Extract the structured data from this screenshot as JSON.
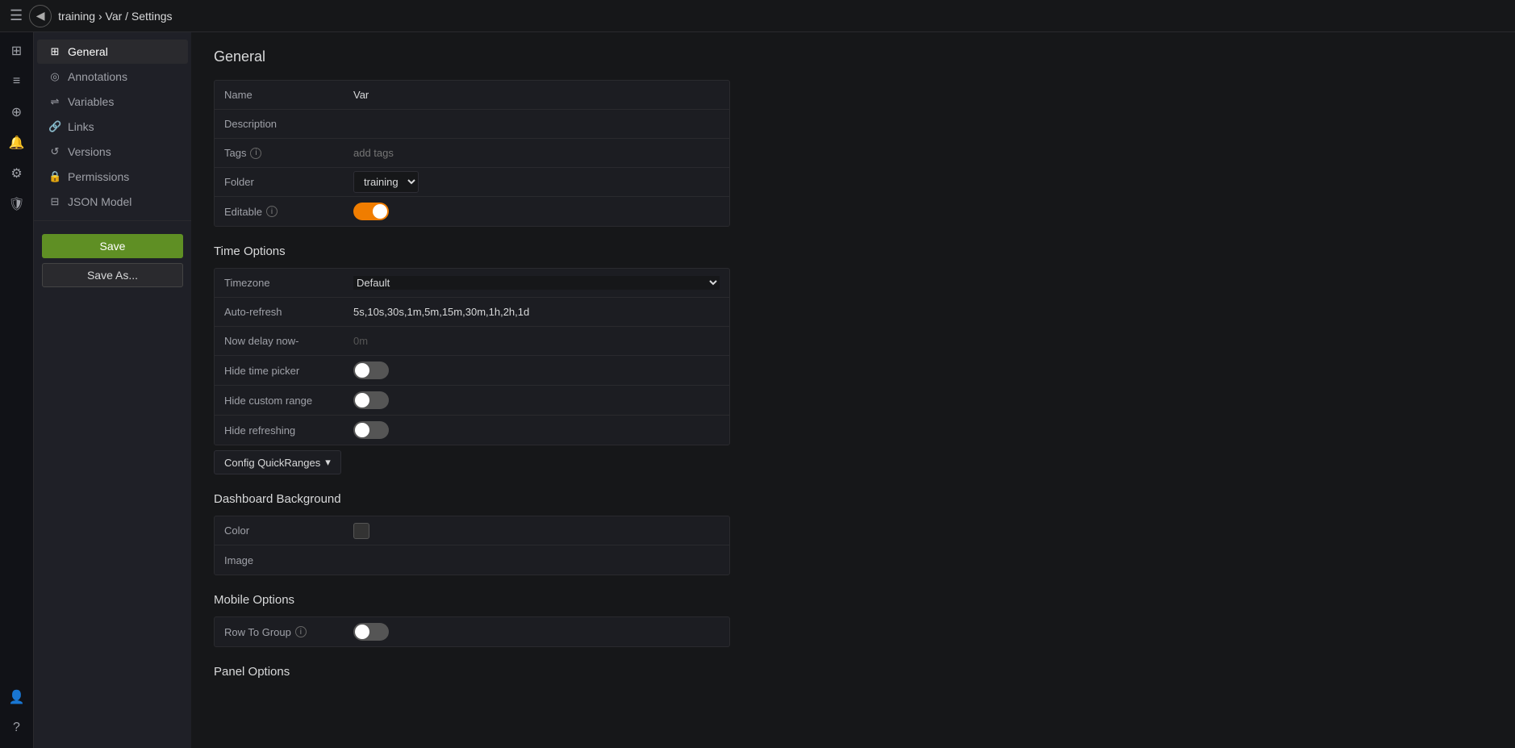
{
  "topbar": {
    "menu_label": "☰",
    "back_label": "◀",
    "breadcrumb_prefix": "training",
    "breadcrumb_separator": " › ",
    "breadcrumb_current": "Var / Settings"
  },
  "sidebar": {
    "items": [
      {
        "id": "general",
        "label": "General",
        "icon": "⊞",
        "active": true
      },
      {
        "id": "annotations",
        "label": "Annotations",
        "icon": "◎"
      },
      {
        "id": "variables",
        "label": "Variables",
        "icon": "⇌"
      },
      {
        "id": "links",
        "label": "Links",
        "icon": "🔗"
      },
      {
        "id": "versions",
        "label": "Versions",
        "icon": "↺"
      },
      {
        "id": "permissions",
        "label": "Permissions",
        "icon": "🔒"
      },
      {
        "id": "json-model",
        "label": "JSON Model",
        "icon": "⊟"
      }
    ],
    "save_label": "Save",
    "save_as_label": "Save As..."
  },
  "iconbar": {
    "icons": [
      {
        "id": "hamburger",
        "symbol": "☰"
      },
      {
        "id": "apps",
        "symbol": "⊞"
      },
      {
        "id": "list",
        "symbol": "☰"
      },
      {
        "id": "globe",
        "symbol": "⊕"
      },
      {
        "id": "bell",
        "symbol": "🔔"
      },
      {
        "id": "gear",
        "symbol": "⚙"
      },
      {
        "id": "shield",
        "symbol": "🛡"
      },
      {
        "id": "user-bottom",
        "symbol": "👤"
      },
      {
        "id": "help",
        "symbol": "?"
      }
    ]
  },
  "general": {
    "section_title": "General",
    "fields": {
      "name_label": "Name",
      "name_value": "Var",
      "description_label": "Description",
      "description_value": "",
      "tags_label": "Tags",
      "tags_placeholder": "add tags",
      "folder_label": "Folder",
      "folder_value": "training",
      "editable_label": "Editable",
      "editable_on": true
    },
    "time_options": {
      "title": "Time Options",
      "timezone_label": "Timezone",
      "timezone_value": "Default",
      "autorefresh_label": "Auto-refresh",
      "autorefresh_value": "5s,10s,30s,1m,5m,15m,30m,1h,2h,1d",
      "now_delay_label": "Now delay now-",
      "now_delay_value": "0m",
      "hide_time_picker_label": "Hide time picker",
      "hide_time_picker_on": false,
      "hide_custom_range_label": "Hide custom range",
      "hide_custom_range_on": false,
      "hide_refreshing_label": "Hide refreshing",
      "hide_refreshing_on": false,
      "config_quickranges_label": "Config QuickRanges",
      "config_quickranges_arrow": "▾"
    },
    "dashboard_bg": {
      "title": "Dashboard Background",
      "color_label": "Color",
      "image_label": "Image",
      "image_value": ""
    },
    "mobile_options": {
      "title": "Mobile Options",
      "row_to_group_label": "Row To Group",
      "row_to_group_on": false
    },
    "panel_options": {
      "title": "Panel Options"
    }
  }
}
